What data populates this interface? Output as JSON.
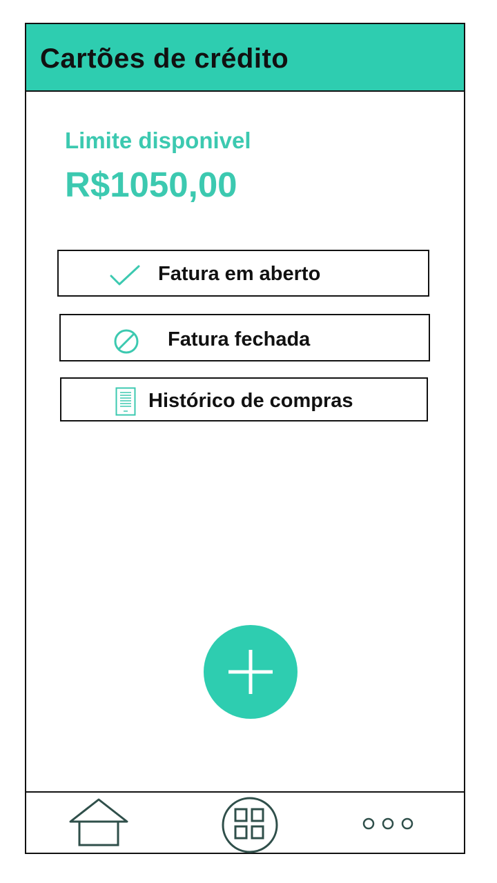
{
  "header": {
    "title": "Cartões de crédito"
  },
  "limit": {
    "label": "Limite disponivel",
    "value": "R$1050,00"
  },
  "menu": {
    "items": [
      {
        "label": "Fatura em aberto",
        "icon": "check-icon"
      },
      {
        "label": "Fatura fechada",
        "icon": "blocked-icon"
      },
      {
        "label": "Histórico de compras",
        "icon": "document-icon"
      }
    ]
  },
  "fab": {
    "icon": "plus-icon"
  },
  "bottom_nav": {
    "items": [
      {
        "icon": "home-icon"
      },
      {
        "icon": "grid-icon"
      },
      {
        "icon": "more-icon"
      }
    ]
  },
  "colors": {
    "accent": "#2ecdb0",
    "text_accent": "#3cc9b0",
    "outline": "#111111",
    "nav_icon": "#2f4f4a"
  }
}
